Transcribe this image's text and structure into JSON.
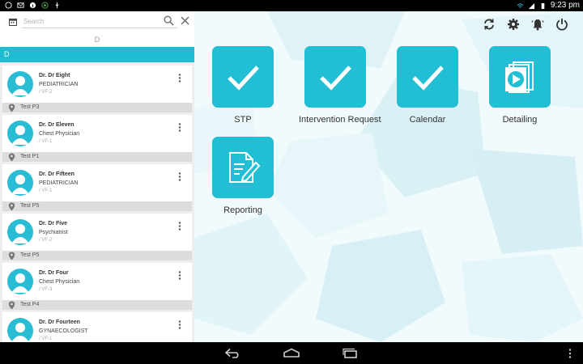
{
  "status_bar": {
    "time": "9:23 pm",
    "icons": [
      "whatsapp-icon",
      "email-icon",
      "info-icon",
      "app-icon",
      "usb-icon",
      "wifi-icon",
      "signal-icon",
      "battery-icon"
    ]
  },
  "sidebar": {
    "search": {
      "placeholder": "Search",
      "value": ""
    },
    "alpha_index": "D",
    "section_header": "D",
    "doctors": [
      {
        "name": "Dr. Dr Eight",
        "specialty": "PEDIATRICIAN",
        "vf": "/ VF-2",
        "location": "Test P3"
      },
      {
        "name": "Dr. Dr Eleven",
        "specialty": "Chest Physician",
        "vf": "/ VF-1",
        "location": "Test P1"
      },
      {
        "name": "Dr. Dr Fifteen",
        "specialty": "PEDIATRICIAN",
        "vf": "/ VF-1",
        "location": "Test P5"
      },
      {
        "name": "Dr. Dr Five",
        "specialty": "Psychiatrist",
        "vf": "/ VF-2",
        "location": "Test P5"
      },
      {
        "name": "Dr. Dr Four",
        "specialty": "Chest Physician",
        "vf": "/ VF-3",
        "location": "Test P4"
      },
      {
        "name": "Dr. Dr Fourteen",
        "specialty": "GYNAECOLOGIST",
        "vf": "/ VF-1",
        "location": ""
      }
    ]
  },
  "toolbar": {
    "icons": [
      "sync-icon",
      "settings-icon",
      "notifications-icon",
      "power-icon"
    ]
  },
  "tiles": [
    {
      "label": "STP",
      "icon": "checkmark-icon"
    },
    {
      "label": "Intervention Request",
      "icon": "checkmark-icon"
    },
    {
      "label": "Calendar",
      "icon": "checkmark-icon"
    },
    {
      "label": "Detailing",
      "icon": "video-icon"
    },
    {
      "label": "Reporting",
      "icon": "report-edit-icon"
    }
  ],
  "colors": {
    "accent": "#22bfd4",
    "section_header": "#1fbcd2"
  }
}
